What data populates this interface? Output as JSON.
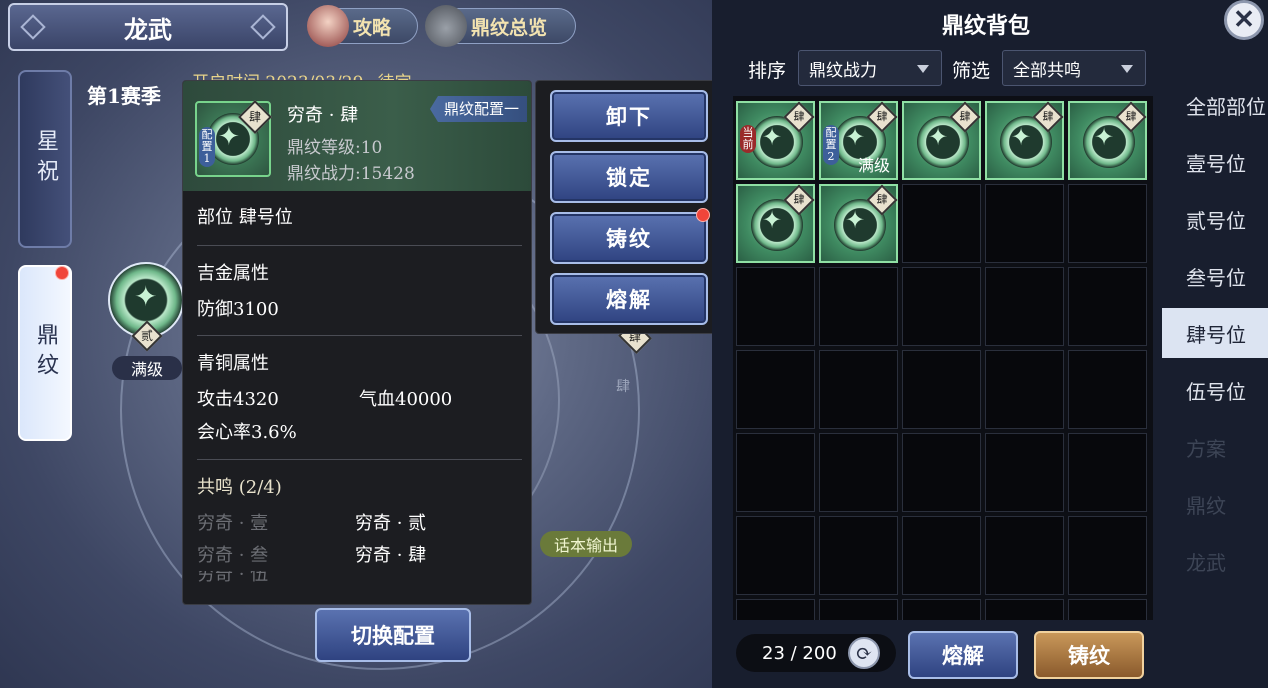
{
  "header": {
    "title": "龙武",
    "guide_label": "攻略",
    "overview_label": "鼎纹总览"
  },
  "left_tabs": [
    {
      "label": "星祝"
    },
    {
      "label": "鼎纹"
    }
  ],
  "season": {
    "label": "第1赛季",
    "open_time": "开启时间 2023/03/29~待定"
  },
  "slot_ring": {
    "slot_char": "贰",
    "level_badge": "满级",
    "slot_char_2": "肆",
    "slot_char_3": "肆"
  },
  "popup": {
    "item_name": "穷奇 · 肆",
    "config_tag": "鼎纹配置一",
    "icon_tag": "配置1",
    "icon_rank": "肆",
    "level": "鼎纹等级:10",
    "power": "鼎纹战力:15428",
    "position": "部位 肆号位",
    "gold_title": "吉金属性",
    "gold_attr": "防御3100",
    "bronze_title": "青铜属性",
    "bronze_attack": "攻击4320",
    "bronze_hp": "气血40000",
    "bronze_crit": "会心率3.6%",
    "resonance_title": "共鸣 (2/4)",
    "resonance": [
      {
        "name": "穷奇 · 壹",
        "active": false
      },
      {
        "name": "穷奇 · 贰",
        "active": true
      },
      {
        "name": "穷奇 · 叁",
        "active": false
      },
      {
        "name": "穷奇 · 肆",
        "active": true
      },
      {
        "name": "穷奇 · 伍",
        "active": false
      }
    ]
  },
  "actions": {
    "unequip": "卸下",
    "lock": "锁定",
    "cast": "铸纹",
    "smelt": "熔解"
  },
  "talk_label": "话本输出",
  "switch_label": "切换配置",
  "bag": {
    "title": "鼎纹背包",
    "sort_label": "排序",
    "sort_value": "鼎纹战力",
    "filter_label": "筛选",
    "filter_value": "全部共鸣",
    "items": [
      {
        "rank": "肆",
        "tag": "当前",
        "tag_color": "#9a2a2a",
        "level": ""
      },
      {
        "rank": "肆",
        "tag": "配置2",
        "tag_color": "#3d5f9a",
        "level": "满级"
      },
      {
        "rank": "肆",
        "tag": "",
        "tag_color": "",
        "level": ""
      },
      {
        "rank": "肆",
        "tag": "",
        "tag_color": "",
        "level": ""
      },
      {
        "rank": "肆",
        "tag": "",
        "tag_color": "",
        "level": ""
      },
      {
        "rank": "肆",
        "tag": "",
        "tag_color": "",
        "level": ""
      },
      {
        "rank": "肆",
        "tag": "",
        "tag_color": "",
        "level": ""
      }
    ],
    "count": "23 / 200",
    "smelt_label": "熔解",
    "cast_label": "铸纹"
  },
  "position_tabs": [
    {
      "label": "全部部位",
      "active": false,
      "faded": false
    },
    {
      "label": "壹号位",
      "active": false,
      "faded": false
    },
    {
      "label": "贰号位",
      "active": false,
      "faded": false
    },
    {
      "label": "叁号位",
      "active": false,
      "faded": false
    },
    {
      "label": "肆号位",
      "active": true,
      "faded": false
    },
    {
      "label": "伍号位",
      "active": false,
      "faded": false
    },
    {
      "label": "方案",
      "active": false,
      "faded": true
    },
    {
      "label": "鼎纹",
      "active": false,
      "faded": true
    },
    {
      "label": "龙武",
      "active": false,
      "faded": true
    }
  ]
}
